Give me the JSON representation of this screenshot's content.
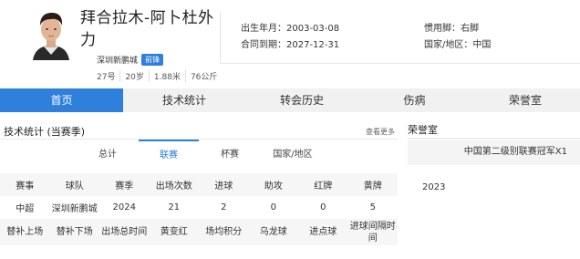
{
  "profile": {
    "name": "拜合拉木-阿卜杜外力",
    "club": "深圳新鹏城",
    "position": "前锋",
    "number": "27号",
    "age": "20岁",
    "height": "1.88米",
    "weight": "76公斤"
  },
  "info": {
    "birth": "出生年月：2003-03-08",
    "foot": "惯用脚：右脚",
    "contract": "合同到期：2027-12-31",
    "nationality": "国家/地区：中国"
  },
  "nav": {
    "tabs": [
      "首页",
      "技术统计",
      "转会历史",
      "伤病",
      "荣誉室"
    ]
  },
  "stats": {
    "title": "技术统计 (当赛季)",
    "see_more": "查看更多",
    "sub_tabs": [
      "总计",
      "联赛",
      "杯赛",
      "国家/地区"
    ],
    "headers1": [
      "赛事",
      "球队",
      "赛季",
      "出场次数",
      "进球",
      "助攻",
      "红牌",
      "黄牌"
    ],
    "row1": [
      "中超",
      "深圳新鹏城",
      "2024",
      "21",
      "2",
      "0",
      "0",
      "5"
    ],
    "headers2": [
      "替补上场",
      "替补下场",
      "出场总时间",
      "黄变红",
      "场均积分",
      "乌龙球",
      "进点球",
      "进球间隔时间"
    ]
  },
  "honors": {
    "title": "荣誉室",
    "item": "中国第二级别联赛冠军X1",
    "year": "2023"
  },
  "colors": {
    "accent": "#2f7fdc"
  }
}
